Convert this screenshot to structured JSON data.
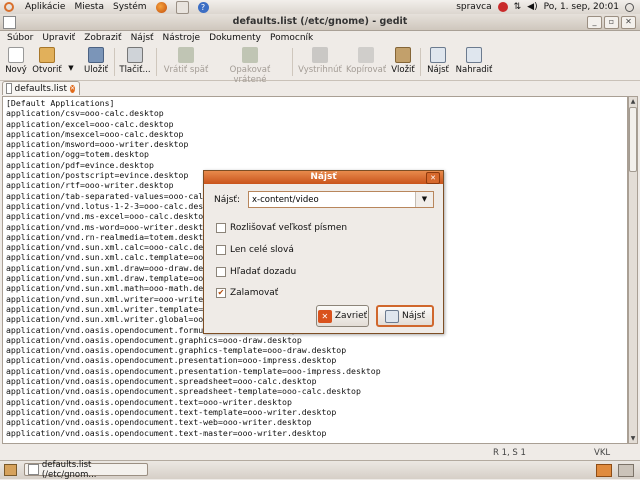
{
  "top_panel": {
    "menu": [
      "Aplikácie",
      "Miesta",
      "Systém"
    ],
    "user": "spravca",
    "datetime": "Po, 1. sep, 20:01"
  },
  "window": {
    "title": "defaults.list (/etc/gnome) - gedit",
    "buttons": [
      "_",
      "▫",
      "✕"
    ]
  },
  "menubar": [
    "Súbor",
    "Upraviť",
    "Zobraziť",
    "Nájsť",
    "Nástroje",
    "Dokumenty",
    "Pomocník"
  ],
  "toolbar": [
    {
      "label": "Nový",
      "icon": "new-icon",
      "enabled": true
    },
    {
      "label": "Otvoriť",
      "icon": "open-icon",
      "enabled": true
    },
    {
      "label": "Uložiť",
      "icon": "save-icon",
      "enabled": true
    },
    {
      "label": "Tlačiť...",
      "icon": "print-icon",
      "enabled": true
    },
    {
      "label": "Vrátiť späť",
      "icon": "undo-icon",
      "enabled": false
    },
    {
      "label": "Opakovať vrátené",
      "icon": "redo-icon",
      "enabled": false
    },
    {
      "label": "Vystrihnúť",
      "icon": "cut-icon",
      "enabled": false
    },
    {
      "label": "Kopírovať",
      "icon": "copy-icon",
      "enabled": false
    },
    {
      "label": "Vložiť",
      "icon": "paste-icon",
      "enabled": true
    },
    {
      "label": "Nájsť",
      "icon": "find-icon",
      "enabled": true
    },
    {
      "label": "Nahradiť",
      "icon": "replace-icon",
      "enabled": true
    }
  ],
  "tab": {
    "label": "defaults.list"
  },
  "editor": {
    "lines": [
      "[Default Applications]",
      "application/csv=ooo-calc.desktop",
      "application/excel=ooo-calc.desktop",
      "application/msexcel=ooo-calc.desktop",
      "application/msword=ooo-writer.desktop",
      "application/ogg=totem.desktop",
      "application/pdf=evince.desktop",
      "application/postscript=evince.desktop",
      "application/rtf=ooo-writer.desktop",
      "application/tab-separated-values=ooo-calc.desktop",
      "application/vnd.lotus-1-2-3=ooo-calc.desktop",
      "application/vnd.ms-excel=ooo-calc.desktop",
      "application/vnd.ms-word=ooo-writer.desktop",
      "application/vnd.rn-realmedia=totem.desktop",
      "application/vnd.sun.xml.calc=ooo-calc.desktop",
      "application/vnd.sun.xml.calc.template=ooo-calc.desktop",
      "application/vnd.sun.xml.draw=ooo-draw.desktop",
      "application/vnd.sun.xml.draw.template=ooo-draw.desktop",
      "application/vnd.sun.xml.math=ooo-math.desktop",
      "application/vnd.sun.xml.writer=ooo-writer.desktop",
      "application/vnd.sun.xml.writer.template=ooo-writer.desktop",
      "application/vnd.sun.xml.writer.global=ooo-writer.desktop",
      "application/vnd.oasis.opendocument.formula=ooo-math.desktop",
      "application/vnd.oasis.opendocument.graphics=ooo-draw.desktop",
      "application/vnd.oasis.opendocument.graphics-template=ooo-draw.desktop",
      "application/vnd.oasis.opendocument.presentation=ooo-impress.desktop",
      "application/vnd.oasis.opendocument.presentation-template=ooo-impress.desktop",
      "application/vnd.oasis.opendocument.spreadsheet=ooo-calc.desktop",
      "application/vnd.oasis.opendocument.spreadsheet-template=ooo-calc.desktop",
      "application/vnd.oasis.opendocument.text=ooo-writer.desktop",
      "application/vnd.oasis.opendocument.text-template=ooo-writer.desktop",
      "application/vnd.oasis.opendocument.text-web=ooo-writer.desktop",
      "application/vnd.oasis.opendocument.text-master=ooo-writer.desktop"
    ]
  },
  "statusbar": {
    "position": "R 1, S 1",
    "mode": "VKL"
  },
  "taskbar": {
    "task": "defaults.list (/etc/gnom..."
  },
  "find_dialog": {
    "title": "Nájsť",
    "find_label": "Nájsť:",
    "find_value": "x-content/video",
    "options": [
      {
        "label": "Rozlišovať veľkosť písmen",
        "checked": false
      },
      {
        "label": "Len celé slová",
        "checked": false
      },
      {
        "label": "Hľadať dozadu",
        "checked": false
      },
      {
        "label": "Zalamovať",
        "checked": true
      }
    ],
    "close_label": "Zavrieť",
    "find_button_label": "Nájsť"
  },
  "colors": {
    "accent": "#d0672d",
    "dialog_title": "#c9541b",
    "close_icon": "#e06a1b"
  }
}
